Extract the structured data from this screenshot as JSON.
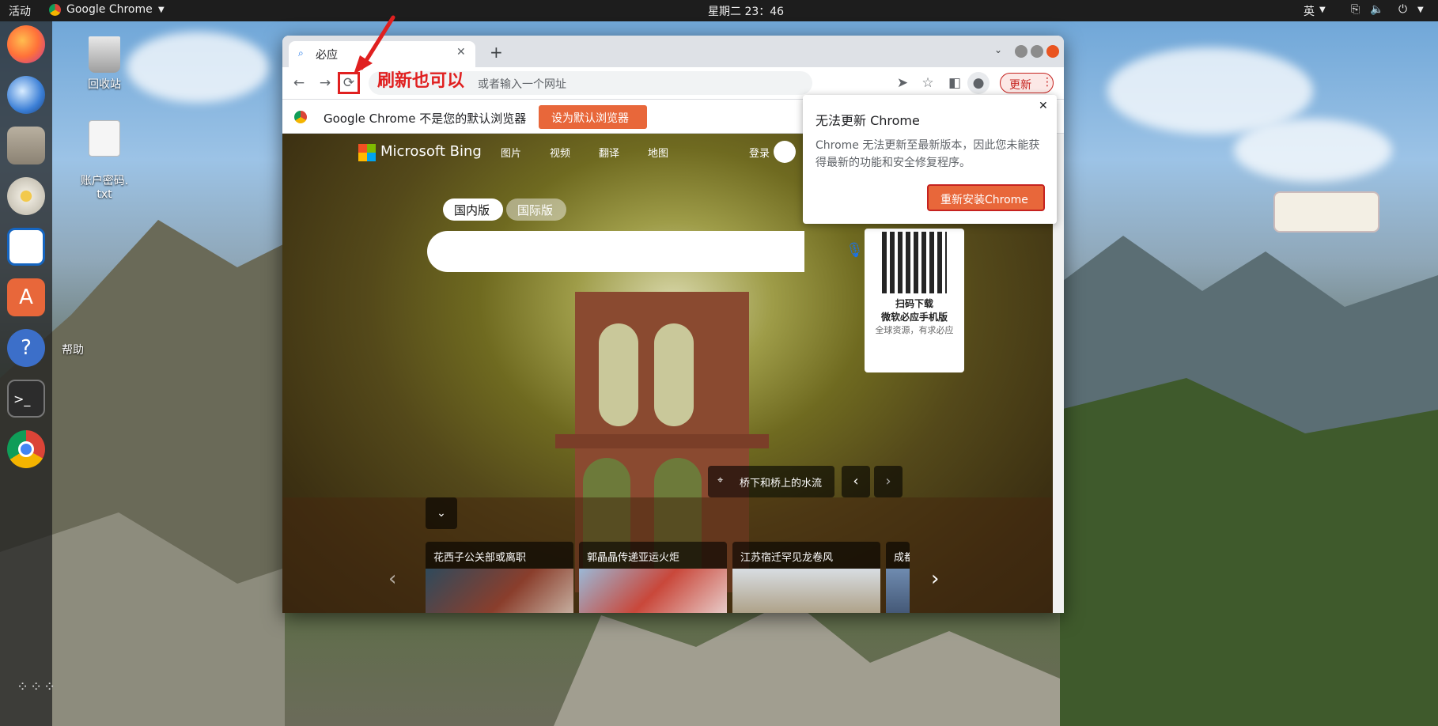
{
  "topbar": {
    "activities": "活动",
    "app_name": "Google Chrome",
    "clock": "星期二 23：46",
    "input_method": "英"
  },
  "desktop": {
    "icons": [
      {
        "label": "回收站"
      },
      {
        "label": "账户密码.\ntxt"
      }
    ],
    "dock_tooltip": "帮助"
  },
  "browser": {
    "tab_title": "必应",
    "omnibox_placeholder": "或者输入一个网址",
    "update_button": "更新",
    "infobar_text": "Google Chrome 不是您的默认浏览器",
    "set_default_button": "设为默认浏览器"
  },
  "annotation": {
    "text": "刷新也可以"
  },
  "popup": {
    "title": "无法更新 Chrome",
    "body": "Chrome 无法更新至最新版本，因此您未能获得最新的功能和安全修复程序。",
    "button": "重新安装Chrome"
  },
  "bing": {
    "logo_text": "Microsoft Bing",
    "nav": [
      "图片",
      "视频",
      "翻译",
      "地图"
    ],
    "login": "登录",
    "region_tabs": [
      "国内版",
      "国际版"
    ],
    "qr_title": "扫码下载",
    "qr_subtitle": "微软必应手机版",
    "qr_tagline": "全球资源，有求必应",
    "location_caption": "桥下和桥上的水流",
    "cards": [
      {
        "title": "花西子公关部或离职"
      },
      {
        "title": "郭晶晶传递亚运火炬"
      },
      {
        "title": "江苏宿迁罕见龙卷风"
      },
      {
        "title": "成都"
      }
    ]
  },
  "colors": {
    "accent_orange": "#e8673a",
    "update_red": "#c5221f",
    "annotation_red": "#e02020"
  }
}
